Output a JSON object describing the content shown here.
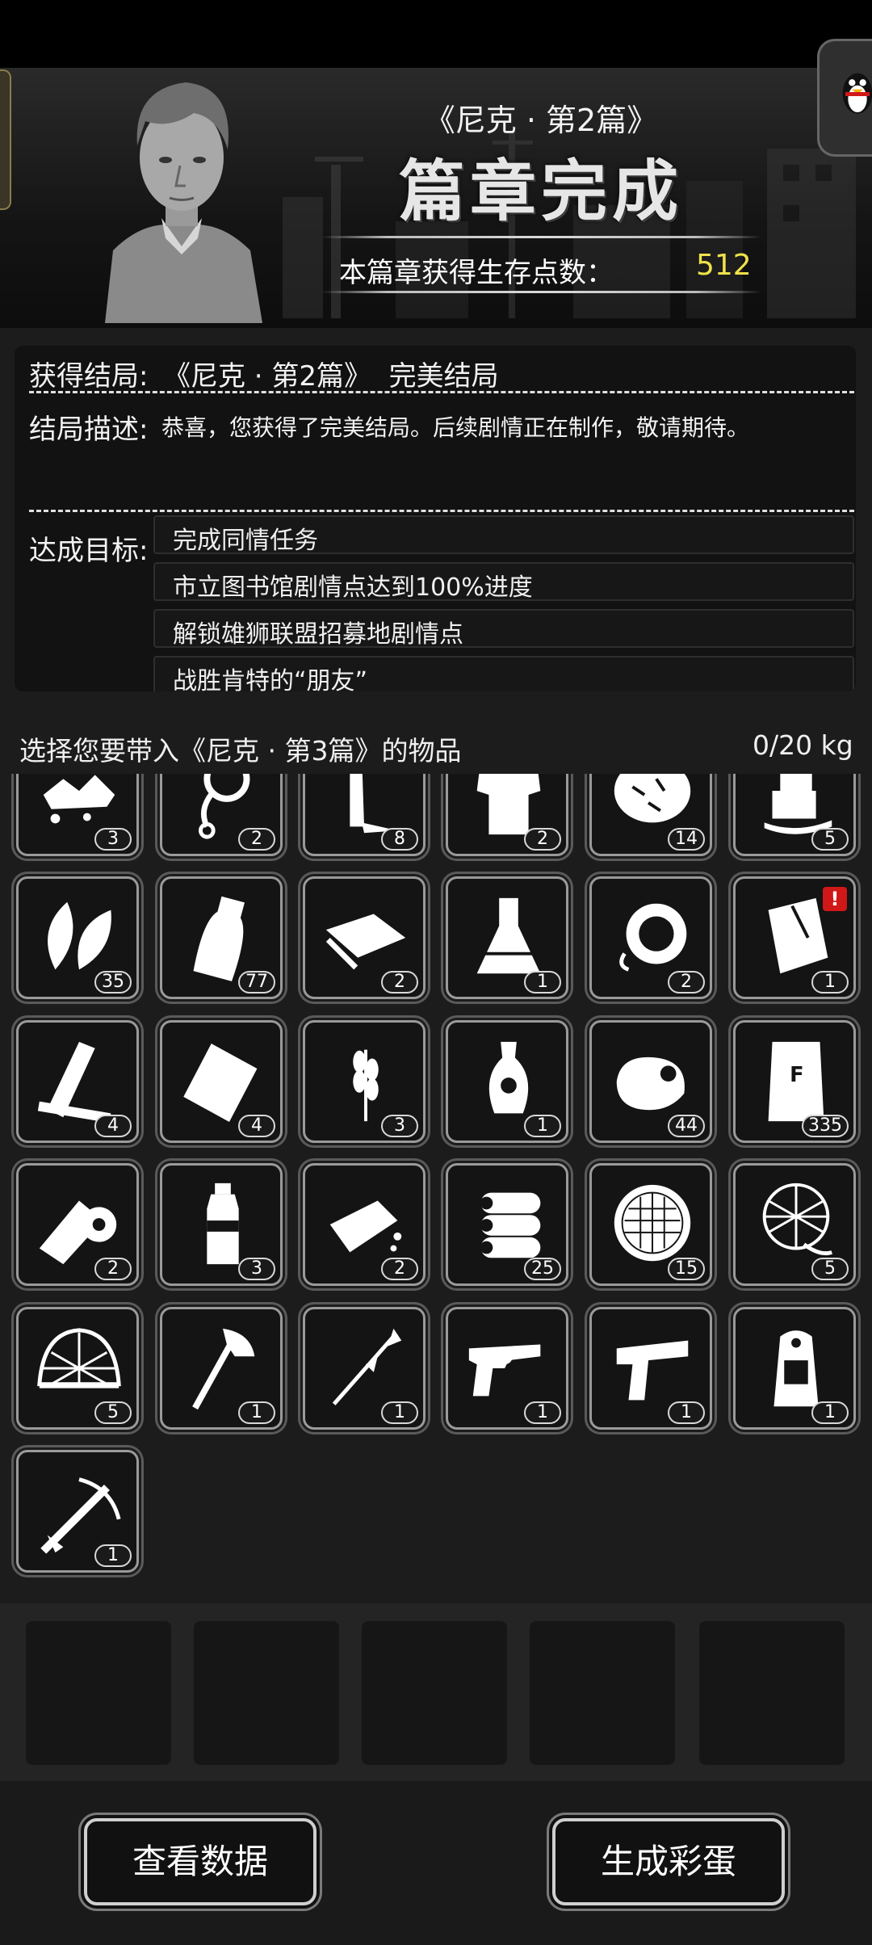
{
  "header": {
    "chapter_subtitle": "《尼克 · 第2篇》",
    "chapter_title": "篇章完成",
    "points_label": "本篇章获得生存点数：",
    "points_value": "512"
  },
  "result": {
    "ending_label": "获得结局:",
    "ending_value": "《尼克 · 第2篇》  完美结局",
    "desc_label": "结局描述:",
    "desc_value": "恭喜，您获得了完美结局。后续剧情正在制作，敬请期待。",
    "goals_label": "达成目标:",
    "goals": [
      "完成同情任务",
      "市立图书馆剧情点达到100%进度",
      "解锁雄狮联盟招募地剧情点",
      "战胜肯特的“朋友”"
    ]
  },
  "inventory": {
    "prompt": "选择您要带入《尼克 · 第3篇》的物品",
    "weight": "0/20 kg",
    "items": [
      {
        "icon": "rubble-icon",
        "count": "3"
      },
      {
        "icon": "rope-icon",
        "count": "2"
      },
      {
        "icon": "knife-blade-icon",
        "count": "8"
      },
      {
        "icon": "torn-shirt-icon",
        "count": "2"
      },
      {
        "icon": "fur-pelt-icon",
        "count": "14"
      },
      {
        "icon": "melting-ice-icon",
        "count": "5"
      },
      {
        "icon": "leaves-icon",
        "count": "35"
      },
      {
        "icon": "milk-bottle-icon",
        "count": "77"
      },
      {
        "icon": "cloth-sheets-icon",
        "count": "2"
      },
      {
        "icon": "flask-icon",
        "count": "1"
      },
      {
        "icon": "fan-part-icon",
        "count": "2"
      },
      {
        "icon": "paper-bag-icon",
        "count": "1",
        "alert": "!"
      },
      {
        "icon": "wood-planks-icon",
        "count": "4"
      },
      {
        "icon": "snack-bag-icon",
        "count": "4"
      },
      {
        "icon": "wheat-icon",
        "count": "3"
      },
      {
        "icon": "vase-icon",
        "count": "1"
      },
      {
        "icon": "meat-icon",
        "count": "44"
      },
      {
        "icon": "flour-sack-icon",
        "count": "335"
      },
      {
        "icon": "bandage-roll-icon",
        "count": "2"
      },
      {
        "icon": "water-bottle-icon",
        "count": "3"
      },
      {
        "icon": "bread-icon",
        "count": "2"
      },
      {
        "icon": "logs-icon",
        "count": "25"
      },
      {
        "icon": "filter-mesh-icon",
        "count": "15"
      },
      {
        "icon": "fishing-net-icon",
        "count": "5"
      },
      {
        "icon": "wire-helmet-icon",
        "count": "5"
      },
      {
        "icon": "axe-icon",
        "count": "1"
      },
      {
        "icon": "spear-icon",
        "count": "1"
      },
      {
        "icon": "revolver-icon",
        "count": "1"
      },
      {
        "icon": "pistol-icon",
        "count": "1"
      },
      {
        "icon": "backpack-icon",
        "count": "1"
      },
      {
        "icon": "crossbow-icon",
        "count": "1"
      }
    ]
  },
  "footer": {
    "view_data_label": "查看数据",
    "generate_egg_label": "生成彩蛋"
  }
}
